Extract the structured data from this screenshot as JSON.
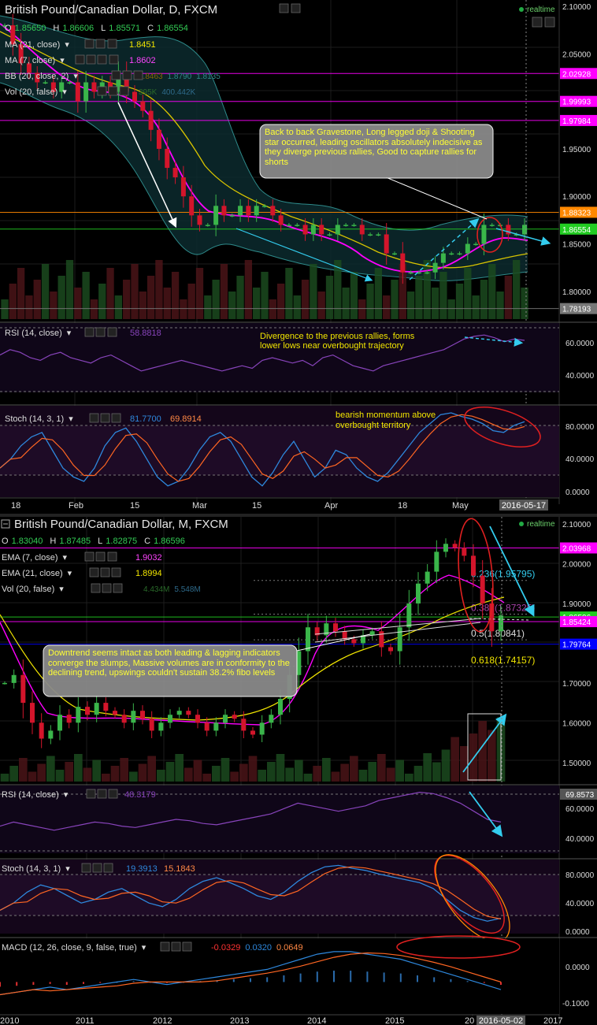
{
  "colors": {
    "bull": "#3ab54a",
    "bear": "#d3152b",
    "bg": "#000000",
    "magenta": "#ff00ff",
    "cyan": "#33ccee",
    "yellow": "#f2e600",
    "orange": "#ff8800",
    "price_tag": "#22cc22"
  },
  "top": {
    "title": "British Pound/Canadian Dollar, D, FXCM",
    "realtime": "realtime",
    "ohlc": {
      "o_lbl": "O",
      "o": "1.85650",
      "h_lbl": "H",
      "h": "1.86606",
      "l_lbl": "L",
      "l": "1.85571",
      "c_lbl": "C",
      "c": "1.86554"
    },
    "studies": [
      {
        "name": "MA (21, close)",
        "values": [
          "1.8451"
        ]
      },
      {
        "name": "MA (7, close)",
        "values": [
          "1.8602"
        ]
      },
      {
        "name": "BB (20, close, 2)",
        "values": [
          "1.8463",
          "1.8790",
          "1.8135"
        ]
      },
      {
        "name": "Vol (20, false)",
        "values": [
          "395K",
          "400.442K"
        ]
      }
    ],
    "price_axis": [
      "2.10000",
      "2.05000",
      "2.00000",
      "1.95000",
      "1.90000",
      "1.85000",
      "1.80000"
    ],
    "level_tags": [
      {
        "label": "2.02928",
        "price": 2.02928,
        "color": "#ff00ff"
      },
      {
        "label": "1.99993",
        "price": 1.99993,
        "color": "#ff00ff"
      },
      {
        "label": "1.97984",
        "price": 1.97984,
        "color": "#ff00ff"
      },
      {
        "label": "1.88323",
        "price": 1.88323,
        "color": "#ff8800"
      },
      {
        "label": "1.86554",
        "price": 1.86554,
        "color": "#22cc22"
      },
      {
        "label": "1.78193",
        "price": 1.78193,
        "color": "#777777"
      }
    ],
    "annotation": "Back to back Gravestone, Long legged doji & Shooting star occurred, leading oscillators absolutely indecisive as they diverge previous rallies, Good to capture rallies for shorts",
    "rsi": {
      "name": "RSI (14, close)",
      "value": "58.8818",
      "note_lines": [
        "Divergence to the previous rallies, forms",
        "lower lows near overbought trajectory"
      ],
      "axis": [
        "60.0000",
        "40.0000"
      ]
    },
    "stoch": {
      "name": "Stoch (14, 3, 1)",
      "k": "81.7700",
      "d": "69.8914",
      "note_lines": [
        "bearish momentum above",
        "overbought territory"
      ],
      "axis": [
        "80.0000",
        "40.0000",
        "0.0000"
      ]
    },
    "time_axis": [
      "18",
      "Feb",
      "15",
      "Mar",
      "15",
      "Apr",
      "18",
      "May"
    ],
    "date_tag": "2016-05-17"
  },
  "bottom": {
    "title": "British Pound/Canadian Dollar, M, FXCM",
    "realtime": "realtime",
    "ohlc": {
      "o_lbl": "O",
      "o": "1.83040",
      "h_lbl": "H",
      "h": "1.87485",
      "l_lbl": "L",
      "l": "1.82875",
      "c_lbl": "C",
      "c": "1.86596"
    },
    "studies": [
      {
        "name": "EMA (7, close)",
        "values": [
          "1.9032"
        ]
      },
      {
        "name": "EMA (21, close)",
        "values": [
          "1.8994"
        ]
      },
      {
        "name": "Vol (20, false)",
        "values": [
          "4.434M",
          "5.548M"
        ]
      }
    ],
    "price_axis": [
      "2.10000",
      "2.00000",
      "1.90000",
      "1.70000",
      "1.60000",
      "1.50000"
    ],
    "level_tags": [
      {
        "label": "2.03968",
        "price": 2.03968,
        "color": "#ff00ff"
      },
      {
        "label": "1.86596",
        "price": 1.86596,
        "color": "#22cc22"
      },
      {
        "label": "1.85424",
        "price": 1.85424,
        "color": "#ff00ff"
      },
      {
        "label": "1.79764",
        "price": 1.79764,
        "color": "#0000ff"
      }
    ],
    "fib": [
      {
        "label": "0.236(1.95795)",
        "price": 1.95795,
        "color": "#33ccee"
      },
      {
        "label": "0.382(1.87325)",
        "price": 1.87325,
        "color": "#aa44aa"
      },
      {
        "label": "0.5(1.80841)",
        "price": 1.80841,
        "color": "#dddddd"
      },
      {
        "label": "0.618(1.74157)",
        "price": 1.74157,
        "color": "#f2e600"
      }
    ],
    "annotation": "Downtrend seems intact as both leading & lagging indicators converge the slumps, Massive volumes are in conformity to the declining trend, upswings couldn't sustain 38.2% fibo levels",
    "rsi": {
      "name": "RSI (14, close)",
      "value": "48.3179",
      "tag": "69.8573",
      "axis": [
        "60.0000",
        "40.0000"
      ]
    },
    "stoch": {
      "name": "Stoch (14, 3, 1)",
      "k": "19.3913",
      "d": "15.1843",
      "axis": [
        "80.0000",
        "40.0000",
        "0.0000"
      ]
    },
    "macd": {
      "name": "MACD (12, 26, close, 9, false, true)",
      "v1": "-0.0329",
      "v2": "0.0320",
      "v3": "0.0649",
      "axis": [
        "0.0000",
        "-0.1000"
      ]
    },
    "time_axis": [
      "2010",
      "2011",
      "2012",
      "2013",
      "2014",
      "2015",
      "20",
      "2017"
    ],
    "date_tag": "2016-05-02"
  },
  "chart_data": [
    {
      "type": "candlestick",
      "title": "British Pound/Canadian Dollar, D, FXCM",
      "timeframe": "D",
      "x_ticks": [
        "18",
        "Feb",
        "15",
        "Mar",
        "15",
        "Apr",
        "18",
        "May"
      ],
      "ylim": [
        1.775,
        2.1
      ],
      "last": {
        "open": 1.8565,
        "high": 1.86606,
        "low": 1.85571,
        "close": 1.86554
      },
      "close_path": [
        2.08,
        2.06,
        2.04,
        2.03,
        2.02,
        2.02,
        2.01,
        2.02,
        2.02,
        2.0,
        2.02,
        2.01,
        2.02,
        2.01,
        2.03,
        2.01,
        2.0,
        1.99,
        1.97,
        1.95,
        1.93,
        1.92,
        1.9,
        1.88,
        1.87,
        1.87,
        1.89,
        1.88,
        1.88,
        1.89,
        1.88,
        1.89,
        1.89,
        1.88,
        1.87,
        1.87,
        1.87,
        1.86,
        1.87,
        1.86,
        1.86,
        1.87,
        1.87,
        1.87,
        1.86,
        1.86,
        1.86,
        1.84,
        1.84,
        1.82,
        1.82,
        1.82,
        1.82,
        1.83,
        1.84,
        1.84,
        1.84,
        1.85,
        1.85,
        1.87,
        1.87,
        1.87,
        1.86,
        1.86,
        1.87
      ],
      "indicators": {
        "MA21": 1.8451,
        "MA7": 1.8602,
        "BB_mid": 1.8463,
        "BB_upper": 1.879,
        "BB_lower": 1.8135,
        "RSI14": 58.8818,
        "Stoch_K": 81.77,
        "Stoch_D": 69.8914
      },
      "rsi_path": [
        48,
        52,
        50,
        46,
        44,
        48,
        50,
        46,
        44,
        42,
        46,
        48,
        44,
        40,
        36,
        38,
        40,
        42,
        44,
        42,
        40,
        38,
        36,
        38,
        40,
        38,
        44,
        46,
        44,
        42,
        44,
        40,
        46,
        48,
        44,
        40,
        38,
        36,
        40,
        42,
        44,
        46,
        48,
        50,
        52,
        56,
        60,
        62,
        63,
        61,
        58,
        60,
        59
      ],
      "stoch_path": [
        30,
        40,
        55,
        65,
        70,
        50,
        30,
        20,
        15,
        30,
        55,
        70,
        75,
        60,
        40,
        20,
        10,
        15,
        30,
        50,
        65,
        70,
        60,
        40,
        20,
        10,
        25,
        45,
        60,
        40,
        20,
        30,
        50,
        45,
        30,
        20,
        15,
        25,
        40,
        55,
        70,
        80,
        90,
        92,
        88,
        85,
        80,
        72,
        70,
        78,
        82
      ],
      "levels": [
        2.02928,
        1.99993,
        1.97984,
        1.88323,
        1.86554,
        1.78193
      ]
    },
    {
      "type": "candlestick",
      "title": "British Pound/Canadian Dollar, M, FXCM",
      "timeframe": "M",
      "x_ticks": [
        "2010",
        "2011",
        "2012",
        "2013",
        "2014",
        "2015",
        "20",
        "2017"
      ],
      "ylim": [
        1.45,
        2.11
      ],
      "last": {
        "open": 1.8304,
        "high": 1.87485,
        "low": 1.82875,
        "close": 1.86596
      },
      "close_path": [
        1.7,
        1.72,
        1.65,
        1.6,
        1.56,
        1.58,
        1.62,
        1.6,
        1.64,
        1.62,
        1.65,
        1.63,
        1.62,
        1.6,
        1.63,
        1.61,
        1.58,
        1.6,
        1.62,
        1.63,
        1.62,
        1.6,
        1.58,
        1.6,
        1.62,
        1.61,
        1.58,
        1.57,
        1.6,
        1.62,
        1.66,
        1.72,
        1.78,
        1.84,
        1.82,
        1.85,
        1.83,
        1.81,
        1.8,
        1.82,
        1.83,
        1.79,
        1.78,
        1.84,
        1.9,
        1.95,
        1.98,
        2.03,
        2.05,
        2.04,
        2.02,
        1.97,
        1.9,
        1.83,
        1.87
      ],
      "fib_levels": {
        "0.236": 1.95795,
        "0.382": 1.87325,
        "0.5": 1.80841,
        "0.618": 1.74157
      },
      "indicators": {
        "EMA7": 1.9032,
        "EMA21": 1.8994,
        "RSI14": 48.3179,
        "Stoch_K": 19.3913,
        "Stoch_D": 15.1843,
        "MACD": -0.0329,
        "MACD_signal": 0.032,
        "MACD_hist": 0.0649
      },
      "rsi_path": [
        45,
        48,
        46,
        44,
        42,
        44,
        46,
        48,
        47,
        45,
        44,
        46,
        48,
        50,
        49,
        47,
        46,
        48,
        50,
        52,
        54,
        58,
        62,
        60,
        58,
        56,
        58,
        60,
        64,
        66,
        68,
        70,
        69,
        66,
        62,
        56,
        50,
        48
      ],
      "stoch_path": [
        30,
        40,
        55,
        65,
        60,
        50,
        40,
        45,
        55,
        60,
        50,
        40,
        35,
        45,
        60,
        70,
        75,
        68,
        60,
        50,
        45,
        55,
        70,
        82,
        90,
        92,
        88,
        85,
        80,
        76,
        72,
        68,
        60,
        45,
        30,
        20,
        15,
        19
      ],
      "macd_path": [
        -0.05,
        -0.04,
        -0.03,
        -0.02,
        -0.03,
        -0.02,
        -0.01,
        0,
        0.01,
        0,
        -0.01,
        0,
        0.01,
        0.02,
        0.03,
        0.04,
        0.05,
        0.07,
        0.09,
        0.11,
        0.12,
        0.12,
        0.11,
        0.1,
        0.09,
        0.07,
        0.05,
        0.03,
        0.01,
        -0.01,
        -0.03
      ],
      "levels": [
        2.03968,
        1.86596,
        1.85424,
        1.79764
      ]
    }
  ]
}
